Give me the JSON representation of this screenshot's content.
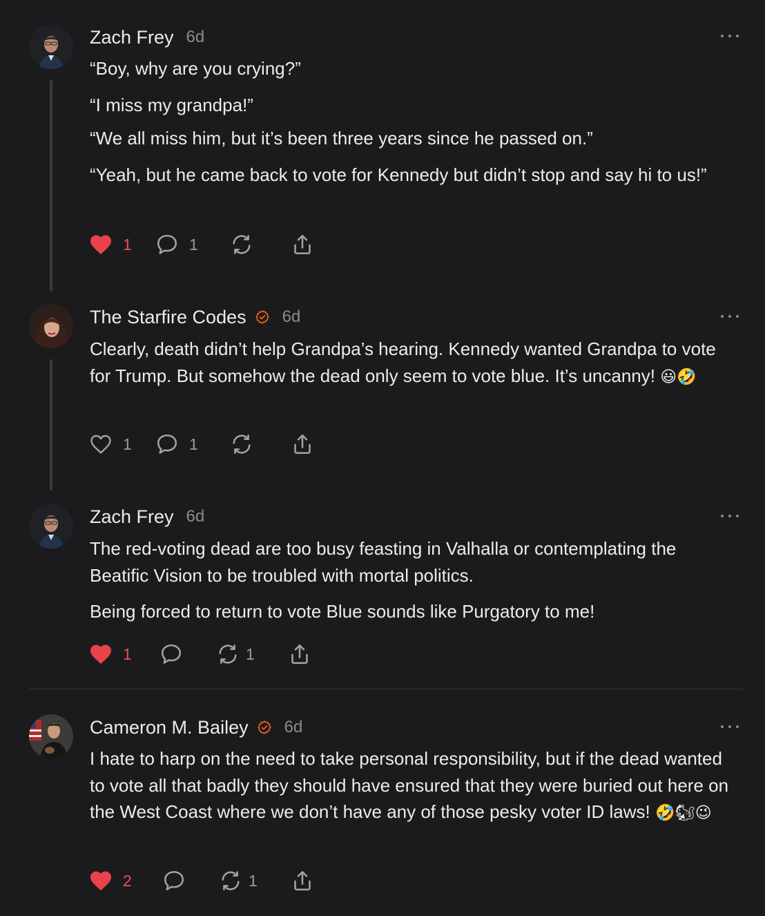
{
  "comments": [
    {
      "author": "Zach Frey",
      "time": "6d",
      "verified": false,
      "paragraphs": [
        "“Boy, why are you crying?”",
        "“I miss my grandpa!”",
        "“We all miss him, but it’s been three years since he passed on.”",
        "“Yeah, but he came back to vote for Kennedy but didn’t stop and say hi to us!”"
      ],
      "likes": "1",
      "liked": true,
      "replies": "1",
      "restacks": ""
    },
    {
      "author": "The Starfire Codes",
      "time": "6d",
      "verified": true,
      "paragraphs": [
        "Clearly, death didn’t help Grandpa’s hearing. Kennedy wanted Grandpa to vote for Trump. But somehow the dead only seem to vote blue. It’s uncanny!"
      ],
      "emojis": "😃🤣",
      "likes": "1",
      "liked": false,
      "replies": "1",
      "restacks": ""
    },
    {
      "author": "Zach Frey",
      "time": "6d",
      "verified": false,
      "paragraphs": [
        "The red-voting dead are too busy feasting in Valhalla or contemplating the Beatific Vision to be troubled with mortal politics.",
        "Being forced to return to vote Blue sounds like Purgatory to me!"
      ],
      "likes": "1",
      "liked": true,
      "replies": "",
      "restacks": "1"
    },
    {
      "author": "Cameron M. Bailey",
      "time": "6d",
      "verified": true,
      "paragraphs": [
        "I hate to harp on the need to take personal responsibility, but if the dead wanted to vote all that badly they should have ensured that they were buried out here on the West Coast where we don’t have any of those pesky voter ID laws!"
      ],
      "emojis": "🤣🐿😉",
      "likes": "2",
      "liked": true,
      "replies": "",
      "restacks": "1"
    }
  ],
  "icons": {
    "like": "heart-icon",
    "reply": "comment-bubble-icon",
    "restack": "restack-icon",
    "share": "share-icon",
    "more": "more-dots-icon",
    "verified": "verified-check-icon"
  },
  "colors": {
    "background": "#1b1b1d",
    "liked_heart": "#e8424a",
    "verified": "#ff6719",
    "muted": "#8c8c90"
  }
}
